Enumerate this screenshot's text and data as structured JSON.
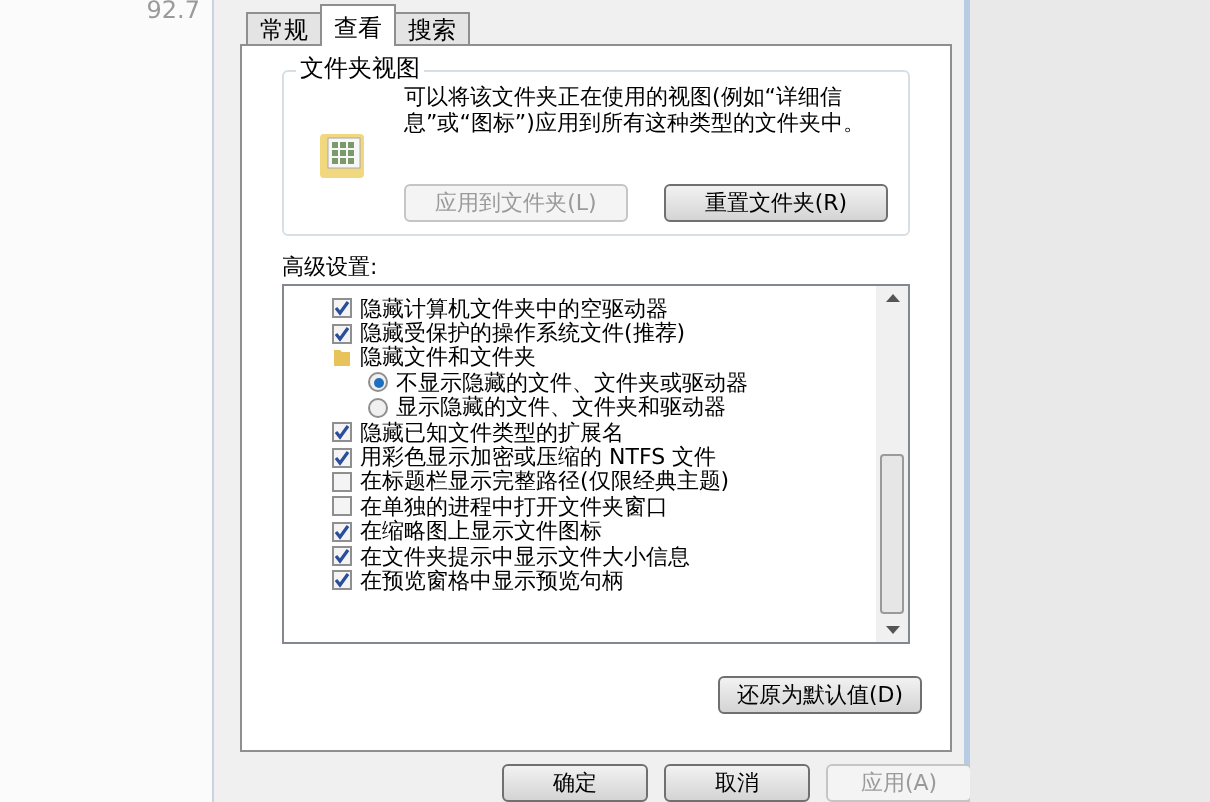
{
  "background": {
    "text": "92.7"
  },
  "tabs": [
    {
      "label": "常规",
      "selected": false
    },
    {
      "label": "查看",
      "selected": true
    },
    {
      "label": "搜索",
      "selected": false
    }
  ],
  "folder_views": {
    "title": "文件夹视图",
    "description": "可以将该文件夹正在使用的视图(例如“详细信息”或“图标”)应用到所有这种类型的文件夹中。",
    "buttons": [
      {
        "label": "应用到文件夹(L)",
        "disabled": true
      },
      {
        "label": "重置文件夹(R)",
        "disabled": false
      }
    ]
  },
  "advanced": {
    "label": "高级设置:",
    "items": [
      {
        "kind": "checkbox",
        "label": "隐藏计算机文件夹中的空驱动器",
        "checked": true
      },
      {
        "kind": "checkbox",
        "label": "隐藏受保护的操作系统文件(推荐)",
        "checked": true
      },
      {
        "kind": "folder",
        "label": "隐藏文件和文件夹",
        "children": [
          {
            "kind": "radio",
            "label": "不显示隐藏的文件、文件夹或驱动器",
            "selected": true
          },
          {
            "kind": "radio",
            "label": "显示隐藏的文件、文件夹和驱动器",
            "selected": false
          }
        ]
      },
      {
        "kind": "checkbox",
        "label": "隐藏已知文件类型的扩展名",
        "checked": true
      },
      {
        "kind": "checkbox",
        "label": "用彩色显示加密或压缩的 NTFS 文件",
        "checked": true
      },
      {
        "kind": "checkbox",
        "label": "在标题栏显示完整路径(仅限经典主题)",
        "checked": false
      },
      {
        "kind": "checkbox",
        "label": "在单独的进程中打开文件夹窗口",
        "checked": false
      },
      {
        "kind": "checkbox",
        "label": "在缩略图上显示文件图标",
        "checked": true
      },
      {
        "kind": "checkbox",
        "label": "在文件夹提示中显示文件大小信息",
        "checked": true
      },
      {
        "kind": "checkbox",
        "label": "在预览窗格中显示预览句柄",
        "checked": true
      }
    ],
    "restore_button": "还原为默认值(D)"
  },
  "footer_buttons": [
    {
      "label": "确定",
      "disabled": false
    },
    {
      "label": "取消",
      "disabled": false
    },
    {
      "label": "应用(A)",
      "disabled": true
    }
  ]
}
